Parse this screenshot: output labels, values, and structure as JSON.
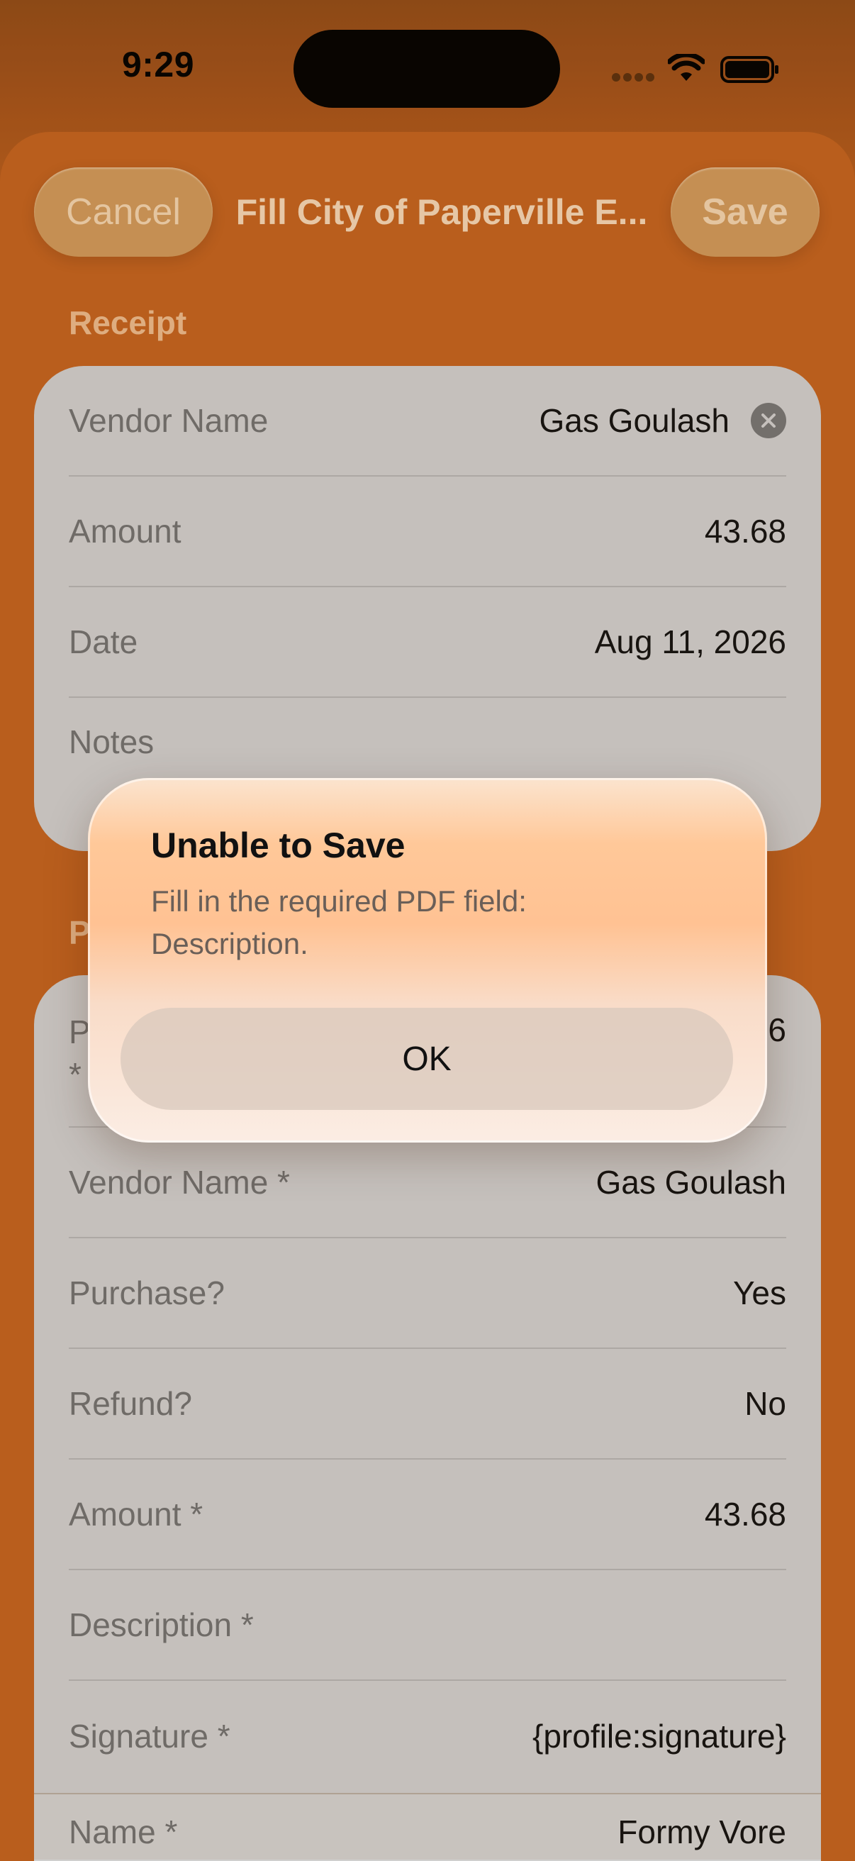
{
  "status_bar": {
    "time": "9:29"
  },
  "nav": {
    "cancel_label": "Cancel",
    "title": "Fill City of Paperville E...",
    "save_label": "Save"
  },
  "receipt": {
    "header": "Receipt",
    "rows": [
      {
        "label": "Vendor Name",
        "value": "Gas Goulash"
      },
      {
        "label": "Amount",
        "value": "43.68"
      },
      {
        "label": "Date",
        "value": "Aug 11, 2026"
      },
      {
        "label": "Notes",
        "value": ""
      }
    ]
  },
  "pdf_fields": {
    "header_partial": "P",
    "rows": [
      {
        "label": "Vendor Name *",
        "value": "Gas Goulash"
      },
      {
        "label": "Purchase?",
        "value": "Yes"
      },
      {
        "label": "Refund?",
        "value": "No"
      },
      {
        "label": "Amount *",
        "value": "43.68"
      },
      {
        "label": "Description *",
        "value": ""
      },
      {
        "label": "Signature *",
        "value": "{profile:signature}"
      },
      {
        "label": "Name *",
        "value": "Formy Vore"
      }
    ],
    "partial_first_row": {
      "label_start": "P",
      "label_end": "*",
      "value_end": "6"
    }
  },
  "alert": {
    "title": "Unable to Save",
    "message": "Fill in the required PDF field: Description.",
    "ok_label": "OK"
  },
  "colors": {
    "sheet_background": "#bf611f",
    "card_background": "#cccbcb",
    "alert_tint": "#ffc293"
  }
}
